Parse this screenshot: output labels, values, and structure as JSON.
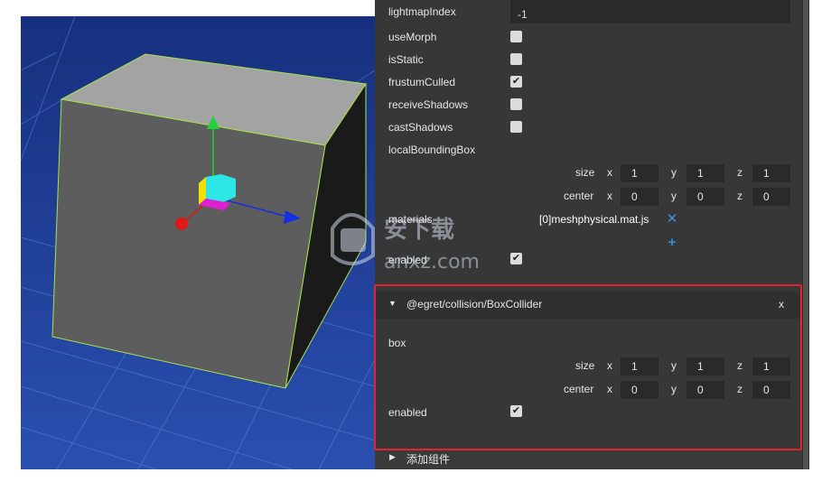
{
  "inspector": {
    "top_field_label": "lightmapIndex",
    "top_field_value": "-1",
    "props": [
      {
        "label": "useMorph",
        "checked": false
      },
      {
        "label": "isStatic",
        "checked": false
      },
      {
        "label": "frustumCulled",
        "checked": true
      },
      {
        "label": "receiveShadows",
        "checked": false
      },
      {
        "label": "castShadows",
        "checked": false
      }
    ],
    "local_bounding_box_label": "localBoundingBox",
    "bbox_size": {
      "label": "size",
      "x": "1",
      "y": "1",
      "z": "1"
    },
    "bbox_center": {
      "label": "center",
      "x": "0",
      "y": "0",
      "z": "0"
    },
    "axis": {
      "x": "x",
      "y": "y",
      "z": "z"
    },
    "materials_label": "materials",
    "material_item": "[0]meshphysical.mat.json",
    "remove_icon": "close-x-icon",
    "add_icon": "plus-icon",
    "enabled_label": "enabled",
    "enabled_checked": true
  },
  "box_collider": {
    "title": "@egret/collision/BoxCollider",
    "close_label": "x",
    "box_label": "box",
    "size": {
      "label": "size",
      "x": "1",
      "y": "1",
      "z": "1"
    },
    "center": {
      "label": "center",
      "x": "0",
      "y": "0",
      "z": "0"
    },
    "enabled_label": "enabled",
    "enabled_checked": true
  },
  "add_component": {
    "label": "添加组件"
  },
  "check_glyph": "✔",
  "colors": {
    "viewport_bg": "#1f3f9a",
    "panel_bg": "#373737",
    "field_bg": "#2a2a2a",
    "accent": "#3a8ee6",
    "highlight": "#e0262a"
  },
  "watermark": {
    "text": "anxz.com"
  }
}
